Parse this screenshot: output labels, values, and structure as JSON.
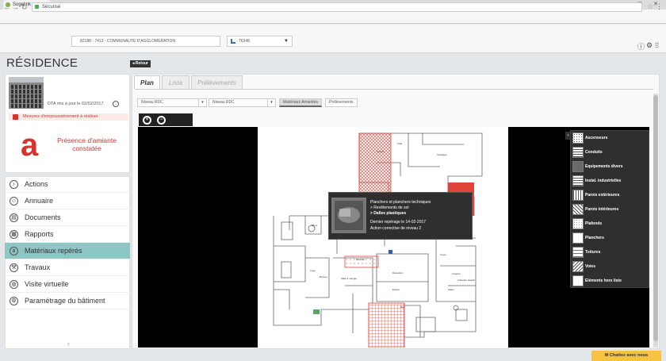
{
  "browser": {
    "tab_title": "Sogelink",
    "address_security": "Sécurisé",
    "address_text": ""
  },
  "header": {
    "collectivity_select": "82188 - 7412 - COMMUNAUTE D'AGGLOMERATION",
    "building_select": "76348"
  },
  "page": {
    "title": "RÉSIDENCE",
    "back_label": "Retour"
  },
  "summary": {
    "dta_text": "DTA mis à jour le 02/02/2017",
    "warning_text": "Mesures d'empoussièrement à réaliser",
    "asbestos_letter": "a",
    "asbestos_status": "Présence d'amiante constatée"
  },
  "menu": {
    "items": [
      {
        "label": "Actions",
        "icon": "chevron-right-icon"
      },
      {
        "label": "Annuaire",
        "icon": "people-icon"
      },
      {
        "label": "Documents",
        "icon": "document-icon"
      },
      {
        "label": "Rapports",
        "icon": "report-icon"
      },
      {
        "label": "Matériaux repérés",
        "icon": "asbestos-icon",
        "active": true
      },
      {
        "label": "Travaux",
        "icon": "works-icon"
      },
      {
        "label": "Visite virtuelle",
        "icon": "globe-icon"
      },
      {
        "label": "Paramétrage du bâtiment",
        "icon": "settings-icon"
      }
    ]
  },
  "tabs": [
    {
      "label": "Plan",
      "active": true
    },
    {
      "label": "Lista",
      "active": false
    },
    {
      "label": "Prélèvements",
      "active": false
    }
  ],
  "filters": {
    "level_select_1": "Niveau RDC",
    "level_select_2": "Niveau RDC",
    "toggle_materials": "Matériaux Amiantés",
    "toggle_samples": "Prélèvements"
  },
  "tooltip": {
    "line1": "Planchers et planchers techniques",
    "line2": "> Revêtements de sol",
    "line3": "> Dalles plastiques",
    "line4": "Dernier repérage le 14-02-2017",
    "line5": "Action corrective de niveau 2"
  },
  "legend": [
    {
      "label": "Ascenseurs",
      "pattern": "dots"
    },
    {
      "label": "Conduits",
      "pattern": "hlines"
    },
    {
      "label": "Equipements divers",
      "pattern": "dense"
    },
    {
      "label": "Instal. industrielles",
      "pattern": "grid"
    },
    {
      "label": "Parois extérieures",
      "pattern": "vlines"
    },
    {
      "label": "Parois intérieures",
      "pattern": "checker"
    },
    {
      "label": "Plafonds",
      "pattern": "lightdots"
    },
    {
      "label": "Planchers",
      "pattern": "plain"
    },
    {
      "label": "Toitures",
      "pattern": "lines"
    },
    {
      "label": "Voies",
      "pattern": "diag"
    },
    {
      "label": "Eléments hors liste",
      "pattern": "plain"
    }
  ],
  "plan_labels": [
    "Cuisine",
    "Café",
    "Stockage",
    "Salle",
    "Blocs",
    "Réunion",
    "Loge",
    "Bureau",
    "Salle à manger",
    "Réception",
    "Entrée",
    "Lingerie",
    "Foyer",
    "Bloc",
    "Français Joseph",
    "Salon"
  ],
  "chat_label": "Chattez avec nous",
  "colors": {
    "accent": "#8ec5c5",
    "warning": "#d9322a",
    "asbestos_zone": "#e0453a"
  }
}
